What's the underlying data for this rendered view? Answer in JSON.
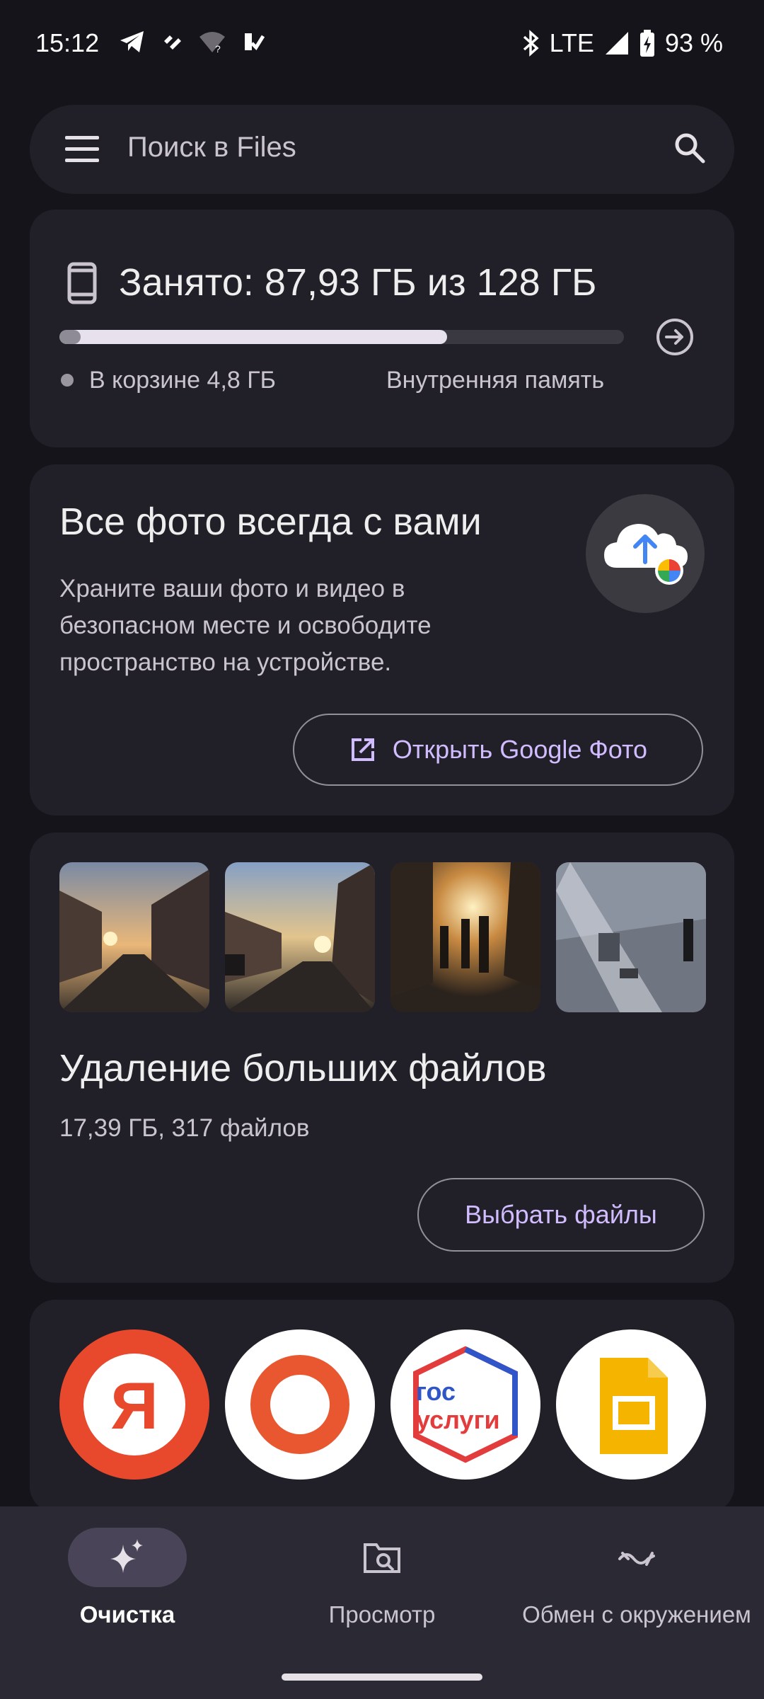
{
  "status_bar": {
    "time": "15:12",
    "network": "LTE",
    "battery": "93 %",
    "left_icons": [
      "telegram-icon",
      "app-icon",
      "wifi-unknown-icon",
      "app-check-icon"
    ],
    "right_icons": [
      "bluetooth-icon",
      "signal-icon",
      "battery-charging-icon"
    ]
  },
  "search": {
    "placeholder": "Поиск в Files",
    "menu_icon": "menu-icon",
    "search_icon": "search-icon"
  },
  "storage": {
    "title": "Занято: 87,93 ГБ из 128 ГБ",
    "used_fraction": 0.687,
    "trash_fraction": 0.0375,
    "trash_label": "В корзине 4,8 ГБ",
    "location_label": "Внутренняя память"
  },
  "photos_promo": {
    "title": "Все фото всегда с вами",
    "description": "Храните ваши фото и видео в безопасном месте и освободите пространство на устройстве.",
    "button": "Открыть Google Фото"
  },
  "large_files": {
    "title": "Удаление больших файлов",
    "subtitle": "17,39 ГБ, 317 файлов",
    "button": "Выбрать файлы",
    "thumbnails": [
      "street-sunset-photo",
      "street-sunset-photo-2",
      "sidewalk-backlit-photo",
      "square-light-rays-photo"
    ]
  },
  "apps": {
    "items": [
      {
        "name": "yandex-app-icon",
        "letter": "Я"
      },
      {
        "name": "orange-ring-app-icon"
      },
      {
        "name": "gosuslugi-app-icon",
        "line1": "гос",
        "line2": "услуги"
      },
      {
        "name": "google-slides-app-icon"
      }
    ]
  },
  "nav": {
    "items": [
      {
        "label": "Очистка",
        "active": true,
        "icon": "sparkle-icon"
      },
      {
        "label": "Просмотр",
        "active": false,
        "icon": "browse-icon"
      },
      {
        "label": "Обмен с окружением",
        "active": false,
        "icon": "nearby-share-icon"
      }
    ]
  },
  "colors": {
    "background": "#15141b",
    "card": "#211f27",
    "accent": "#d0bcff",
    "nav_background": "#2b2933",
    "nav_active_pill": "#4a4458"
  }
}
